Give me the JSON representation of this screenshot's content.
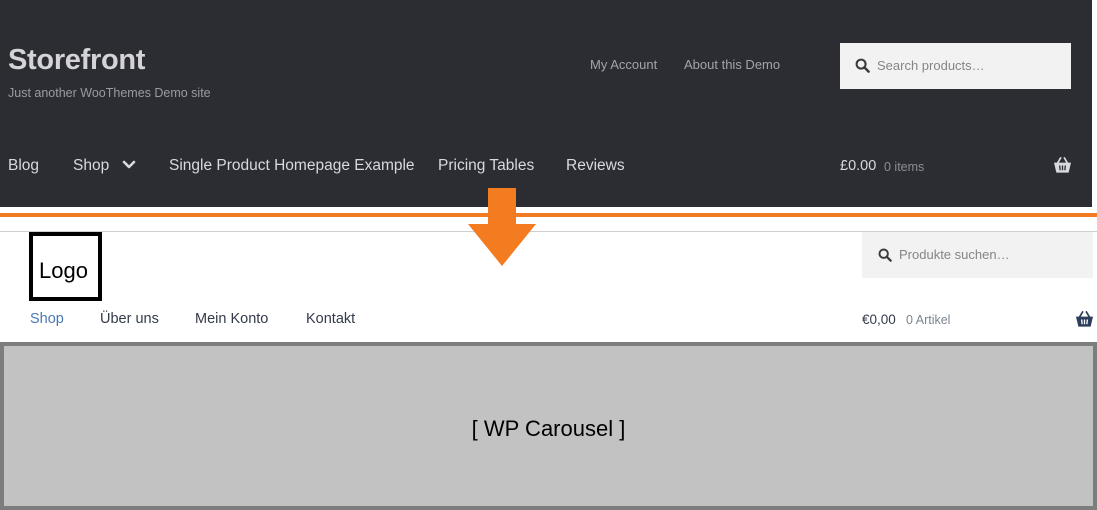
{
  "top": {
    "site_title": "Storefront",
    "site_description": "Just another WooThemes Demo site",
    "secondary_nav": [
      "My Account",
      "About this Demo"
    ],
    "search_placeholder": "Search products…",
    "main_nav": [
      "Blog",
      "Shop",
      "Single Product Homepage Example",
      "Pricing Tables",
      "Reviews"
    ],
    "cart": {
      "amount": "£0.00",
      "count": "0 items"
    }
  },
  "bottom": {
    "logo_text": "Logo",
    "search_placeholder": "Produkte suchen…",
    "main_nav": [
      "Shop",
      "Über uns",
      "Mein Konto",
      "Kontakt"
    ],
    "cart": {
      "amount": "€0,00",
      "count": "0 Artikel"
    },
    "carousel_label": "[ WP Carousel ]"
  },
  "colors": {
    "header_bg": "#2c2d33",
    "accent_orange": "#f47c20",
    "link_blue": "#4a78b4",
    "carousel_bg": "#c2c2c2"
  },
  "icons": [
    "search-icon",
    "chevron-down-icon",
    "basket-icon",
    "down-arrow-icon"
  ]
}
